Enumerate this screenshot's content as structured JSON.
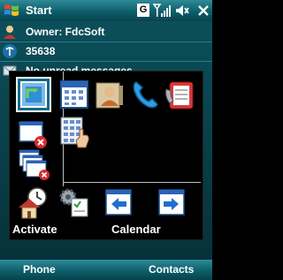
{
  "title_bar": {
    "app_title": "Start",
    "network_type": "G"
  },
  "today": {
    "owner": "Owner: FdcSoft",
    "number": "35638",
    "messages": "No unread messages"
  },
  "launcher": {
    "row_labels": [
      "Activate",
      "Calendar"
    ],
    "icons": [
      "sync-icon",
      "calendar-icon",
      "contacts-icon",
      "phone-icon",
      "phone-list-icon",
      "close-window-icon",
      "dialpad-icon",
      "close-all-windows-icon",
      "clock-home-icon",
      "settings-icon",
      "arrow-left-icon",
      "arrow-right-icon"
    ]
  },
  "soft_keys": {
    "left": "Phone",
    "right": "Contacts"
  },
  "colors": {
    "bar_gradient_top": "#2f8a97",
    "bar_gradient_bottom": "#06434d",
    "background": "#000000",
    "selection": "#0f6b8a"
  }
}
